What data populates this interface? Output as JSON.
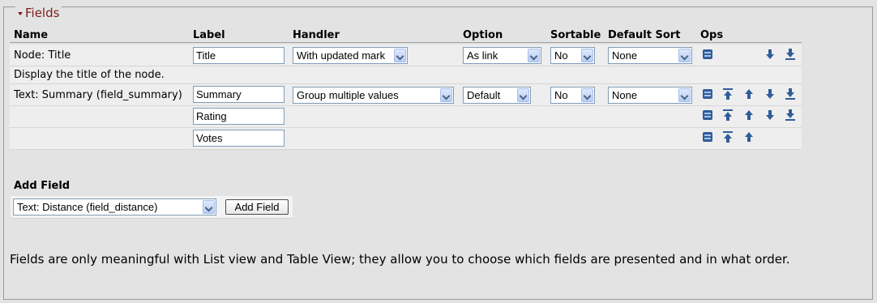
{
  "fieldset": {
    "legend": "Fields"
  },
  "table": {
    "headers": [
      "Name",
      "Label",
      "Handler",
      "Option",
      "Sortable",
      "Default Sort",
      "Ops"
    ],
    "rows": [
      {
        "name": "Node: Title",
        "label": "Title",
        "handler": "With updated mark",
        "option": "As link",
        "sortable": "No",
        "default_sort": "None",
        "ops": [
          "settings",
          "down",
          "bottom"
        ]
      },
      {
        "description": "Display the title of the node."
      },
      {
        "name": "Text: Summary (field_summary)",
        "label": "Summary",
        "handler": "Group multiple values",
        "option": "Default",
        "sortable": "No",
        "default_sort": "None",
        "ops": [
          "settings",
          "top",
          "up",
          "down",
          "bottom"
        ]
      },
      {
        "name": "",
        "label": "Rating",
        "ops": [
          "settings",
          "top",
          "up",
          "down",
          "bottom"
        ]
      },
      {
        "name": "",
        "label": "Votes",
        "ops": [
          "settings",
          "top",
          "up"
        ]
      }
    ]
  },
  "add_field": {
    "heading": "Add Field",
    "selected": "Text: Distance (field_distance)",
    "button": "Add Field"
  },
  "help_text": "Fields are only meaningful with List view and Table View; they allow you to choose which fields are presented and in what order.",
  "colors": {
    "background": "#e3e3e3",
    "row": "#eeeeee",
    "legend": "#7a1b1b",
    "icon": "#3a6aa8"
  }
}
